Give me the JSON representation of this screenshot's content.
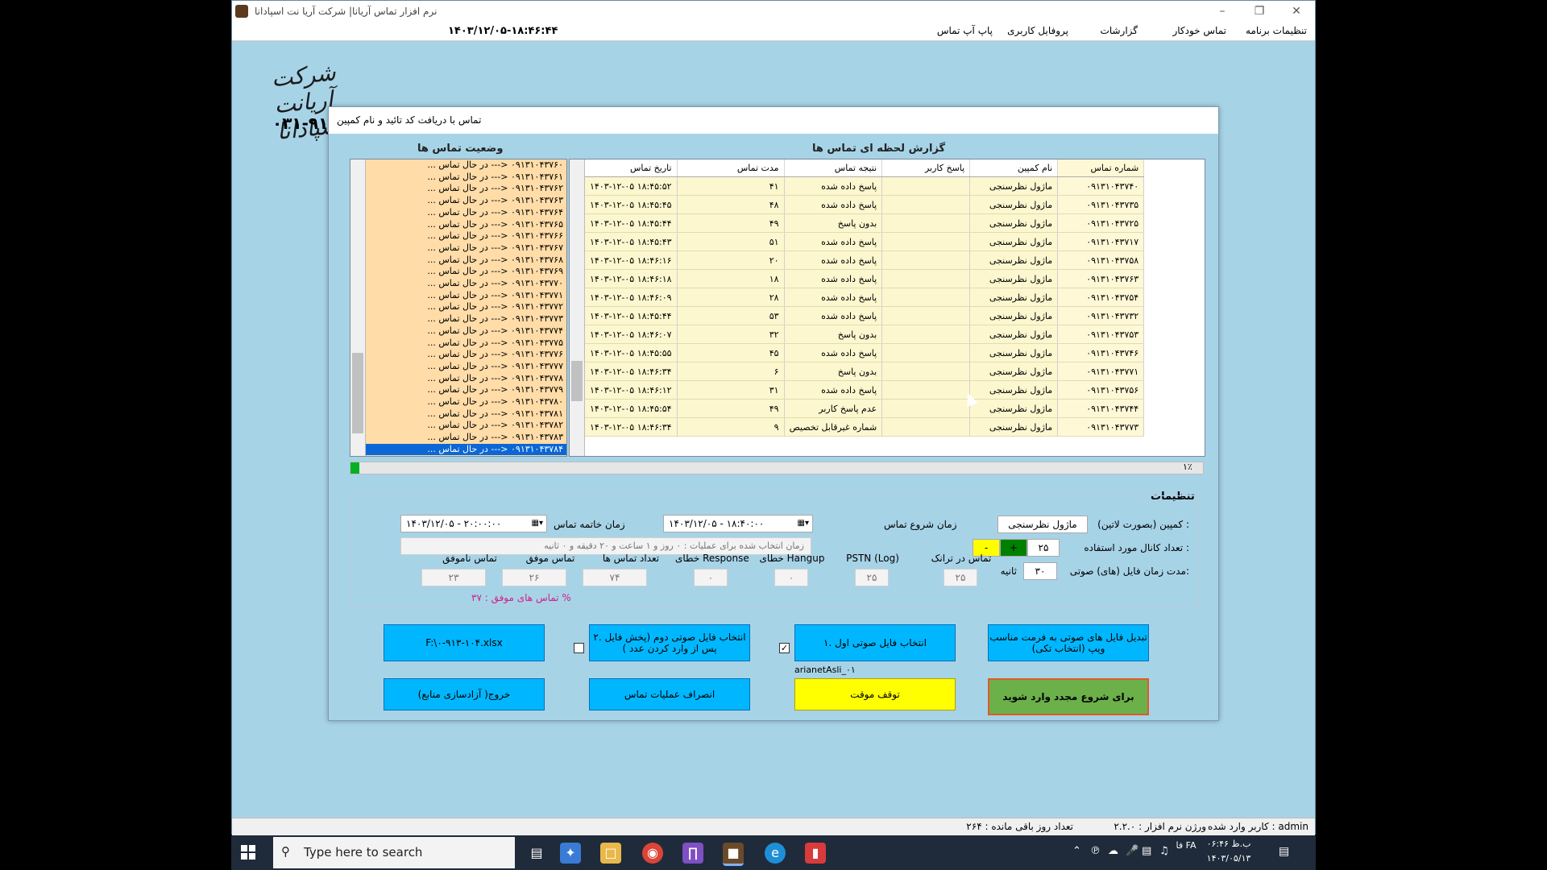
{
  "window": {
    "title": "نرم افزار تماس آریانا| شرکت آریا نت اسپادانا",
    "clock": "۱۴۰۳/۱۲/۰۵-۱۸:۴۶:۴۴"
  },
  "menu": [
    "تنظیمات برنامه",
    "تماس خودکار",
    "گزارشات",
    "پروفایل کاربری",
    "پاپ آپ تماس"
  ],
  "logo": {
    "text": "شرکت آریانت اسپادانا",
    "phone": "۰۳۱-۹۱۵۵"
  },
  "dialog": {
    "title": "تماس با دریافت کد تائید و نام کمپین",
    "status_title": "وضعیت تماس ها",
    "report_title": "گزارش لحظه ای تماس ها",
    "status_rows": [
      "۰۹۱۳۱۰۴۳۷۶۰ <--- در حال تماس ...",
      "۰۹۱۳۱۰۴۳۷۶۱ <--- در حال تماس ...",
      "۰۹۱۳۱۰۴۳۷۶۲ <--- در حال تماس ...",
      "۰۹۱۳۱۰۴۳۷۶۳ <--- در حال تماس ...",
      "۰۹۱۳۱۰۴۳۷۶۴ <--- در حال تماس ...",
      "۰۹۱۳۱۰۴۳۷۶۵ <--- در حال تماس ...",
      "۰۹۱۳۱۰۴۳۷۶۶ <--- در حال تماس ...",
      "۰۹۱۳۱۰۴۳۷۶۷ <--- در حال تماس ...",
      "۰۹۱۳۱۰۴۳۷۶۸ <--- در حال تماس ...",
      "۰۹۱۳۱۰۴۳۷۶۹ <--- در حال تماس ...",
      "۰۹۱۳۱۰۴۳۷۷۰ <--- در حال تماس ...",
      "۰۹۱۳۱۰۴۳۷۷۱ <--- در حال تماس ...",
      "۰۹۱۳۱۰۴۳۷۷۲ <--- در حال تماس ...",
      "۰۹۱۳۱۰۴۳۷۷۳ <--- در حال تماس ...",
      "۰۹۱۳۱۰۴۳۷۷۴ <--- در حال تماس ...",
      "۰۹۱۳۱۰۴۳۷۷۵ <--- در حال تماس ...",
      "۰۹۱۳۱۰۴۳۷۷۶ <--- در حال تماس ...",
      "۰۹۱۳۱۰۴۳۷۷۷ <--- در حال تماس ...",
      "۰۹۱۳۱۰۴۳۷۷۸ <--- در حال تماس ...",
      "۰۹۱۳۱۰۴۳۷۷۹ <--- در حال تماس ...",
      "۰۹۱۳۱۰۴۳۷۸۰ <--- در حال تماس ...",
      "۰۹۱۳۱۰۴۳۷۸۱ <--- در حال تماس ...",
      "۰۹۱۳۱۰۴۳۷۸۲ <--- در حال تماس ...",
      "۰۹۱۳۱۰۴۳۷۸۳ <--- در حال تماس ...",
      "۰۹۱۳۱۰۴۳۷۸۴ <--- در حال تماس ..."
    ],
    "table": {
      "headers": [
        "تاریخ تماس",
        "مدت تماس",
        "نتیجه تماس",
        "پاسخ کاربر",
        "نام کمپین",
        "شماره تماس"
      ],
      "rows": [
        [
          "۱۴۰۳-۱۲-۰۵ ۱۸:۴۵:۵۲",
          "۴۱",
          "پاسخ داده شده",
          "",
          "ماژول نظرسنجی",
          "۰۹۱۳۱۰۴۳۷۴۰"
        ],
        [
          "۱۴۰۳-۱۲-۰۵ ۱۸:۴۵:۴۵",
          "۴۸",
          "پاسخ داده شده",
          "",
          "ماژول نظرسنجی",
          "۰۹۱۳۱۰۴۳۷۳۵"
        ],
        [
          "۱۴۰۳-۱۲-۰۵ ۱۸:۴۵:۴۴",
          "۴۹",
          "بدون پاسخ",
          "",
          "ماژول نظرسنجی",
          "۰۹۱۳۱۰۴۳۷۲۵"
        ],
        [
          "۱۴۰۳-۱۲-۰۵ ۱۸:۴۵:۴۳",
          "۵۱",
          "پاسخ داده شده",
          "",
          "ماژول نظرسنجی",
          "۰۹۱۳۱۰۴۳۷۱۷"
        ],
        [
          "۱۴۰۳-۱۲-۰۵ ۱۸:۴۶:۱۶",
          "۲۰",
          "پاسخ داده شده",
          "",
          "ماژول نظرسنجی",
          "۰۹۱۳۱۰۴۳۷۵۸"
        ],
        [
          "۱۴۰۳-۱۲-۰۵ ۱۸:۴۶:۱۸",
          "۱۸",
          "پاسخ داده شده",
          "",
          "ماژول نظرسنجی",
          "۰۹۱۳۱۰۴۳۷۶۳"
        ],
        [
          "۱۴۰۳-۱۲-۰۵ ۱۸:۴۶:۰۹",
          "۲۸",
          "پاسخ داده شده",
          "",
          "ماژول نظرسنجی",
          "۰۹۱۳۱۰۴۳۷۵۴"
        ],
        [
          "۱۴۰۳-۱۲-۰۵ ۱۸:۴۵:۴۴",
          "۵۳",
          "پاسخ داده شده",
          "",
          "ماژول نظرسنجی",
          "۰۹۱۳۱۰۴۳۷۳۲"
        ],
        [
          "۱۴۰۳-۱۲-۰۵ ۱۸:۴۶:۰۷",
          "۳۲",
          "بدون پاسخ",
          "",
          "ماژول نظرسنجی",
          "۰۹۱۳۱۰۴۳۷۵۳"
        ],
        [
          "۱۴۰۳-۱۲-۰۵ ۱۸:۴۵:۵۵",
          "۴۵",
          "پاسخ داده شده",
          "",
          "ماژول نظرسنجی",
          "۰۹۱۳۱۰۴۳۷۴۶"
        ],
        [
          "۱۴۰۳-۱۲-۰۵ ۱۸:۴۶:۳۴",
          "۶",
          "بدون پاسخ",
          "",
          "ماژول نظرسنجی",
          "۰۹۱۳۱۰۴۳۷۷۱"
        ],
        [
          "۱۴۰۳-۱۲-۰۵ ۱۸:۴۶:۱۲",
          "۳۱",
          "پاسخ داده شده",
          "",
          "ماژول نظرسنجی",
          "۰۹۱۳۱۰۴۳۷۵۶"
        ],
        [
          "۱۴۰۳-۱۲-۰۵ ۱۸:۴۵:۵۴",
          "۴۹",
          "عدم پاسخ کاربر",
          "",
          "ماژول نظرسنجی",
          "۰۹۱۳۱۰۴۳۷۴۴"
        ],
        [
          "۱۴۰۳-۱۲-۰۵ ۱۸:۴۶:۳۴",
          "۹",
          "شماره غیرقابل تخصیص",
          "",
          "ماژول نظرسنجی",
          "۰۹۱۳۱۰۴۳۷۷۳"
        ]
      ]
    },
    "progress": {
      "percent_label": "۱٪",
      "fill_fraction": 0.01
    },
    "settings": {
      "title": "تنظیمات",
      "campaign_label": "کمپین (بصورت لاتین) :",
      "campaign_value": "ماژول نظرسنجی",
      "channels_label": "تعداد کانال مورد استفاده :",
      "channels_value": "۲۵",
      "minus": "-",
      "plus": "+",
      "audio_len_label": "مدت زمان فایل (های) صوتی:",
      "audio_len_value": "۳۰",
      "seconds": "ثانیه",
      "start_label": "زمان شروع تماس",
      "start_value": "۱۴۰۳/۱۲/۰۵ - ۱۸:۴۰:۰۰",
      "end_label": "زمان خاتمه تماس",
      "end_value": "۱۴۰۳/۱۲/۰۵ - ۲۰:۰۰:۰۰",
      "duration_text": "زمان انتخاب شده برای عملیات : ۰ روز و ۱ ساعت و ۲۰ دقیقه و ۰ ثانیه",
      "stats": [
        {
          "label": "تماس در ترانک",
          "value": "۲۵"
        },
        {
          "label": "PSTN (Log)",
          "value": "۲۵"
        },
        {
          "label": "خطای Hangup",
          "value": "۰"
        },
        {
          "label": "خطای Response",
          "value": "۰"
        },
        {
          "label": "تعداد تماس ها",
          "value": "۷۴"
        },
        {
          "label": "تماس موفق",
          "value": "۲۶"
        },
        {
          "label": "تماس ناموفق",
          "value": "۲۳"
        }
      ],
      "success_rate": "تماس های موفق : ۳۷ %"
    },
    "buttons": {
      "convert": "تبدیل فایل های صوتی به فرمت مناسب ویپ (انتخاب تکی)",
      "first_audio": "۱. انتخاب فایل صوتی اول",
      "second_audio": "۲. انتخاب فایل صوتی دوم (پخش فایل پس از وارد کردن عدد )",
      "file": "F:\\۰-۹۱۳-۱۰۴.xlsx",
      "first_audio_file": "arianetAsli_۰۱",
      "restart": "برای شروع مجدد وارد شوید",
      "pause": "توقف موقت",
      "cancel": "انصراف عملیات تماس",
      "exit": "خروج( آزادسازی منابع)",
      "first_checked": true,
      "second_checked": false
    }
  },
  "statusbar": {
    "user": "کاربر وارد شده : admin",
    "version": "ورژن نرم افزار : ۲.۲.۰",
    "days": "تعداد روز باقی مانده : ۲۶۴"
  },
  "taskbar": {
    "search_placeholder": "Type here to search",
    "time": "۰۶:۴۶ ب.ظ",
    "date": "۱۴۰۳/۰۵/۱۳",
    "lang": "فا FA"
  },
  "colors": {
    "background": "#a7d3e7",
    "button": "#00b7ff",
    "pause": "#ffff00",
    "restart": "#6cb04a",
    "grid_row": "#fdf7cf",
    "status_list": "#ffdca8",
    "selected": "#0b67d6"
  }
}
